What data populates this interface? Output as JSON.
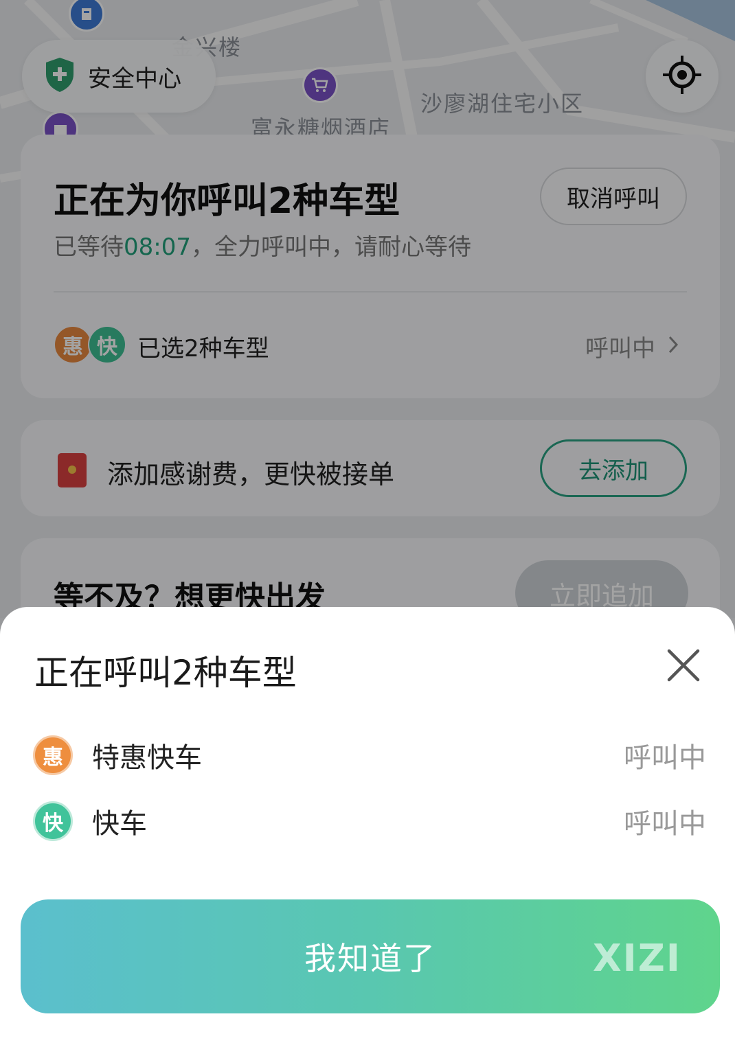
{
  "map": {
    "labels": [
      "金兴楼",
      "富永糖烟酒店",
      "沙廖湖住宅小区"
    ]
  },
  "safety_center": {
    "label": "安全中心",
    "icon": "shield-plus-icon"
  },
  "locate": {
    "icon": "locate-crosshair-icon"
  },
  "main_card": {
    "title": "正在为你呼叫2种车型",
    "waited_prefix": "已等待",
    "waited_time": "08:07",
    "waited_suffix": "，全力呼叫中，请耐心等待",
    "cancel_label": "取消呼叫",
    "badge_1": "惠",
    "badge_2": "快",
    "selected_label": "已选2种车型",
    "status": "呼叫中"
  },
  "fee_card": {
    "text": "添加感谢费，更快被接单",
    "button": "去添加"
  },
  "more_card": {
    "title": "等不及？想更快出发",
    "button": "立即追加"
  },
  "sheet": {
    "title": "正在呼叫2种车型",
    "items": [
      {
        "icon_text": "惠",
        "name": "特惠快车",
        "status": "呼叫中",
        "color": "#ee8e3e"
      },
      {
        "icon_text": "快",
        "name": "快车",
        "status": "呼叫中",
        "color": "#40c39a"
      }
    ],
    "confirm_label": "我知道了",
    "watermark": "XIZI"
  },
  "colors": {
    "accent_green": "#22a07a",
    "button_gradient_start": "#5bbfcd",
    "button_gradient_end": "#5fd48c"
  }
}
